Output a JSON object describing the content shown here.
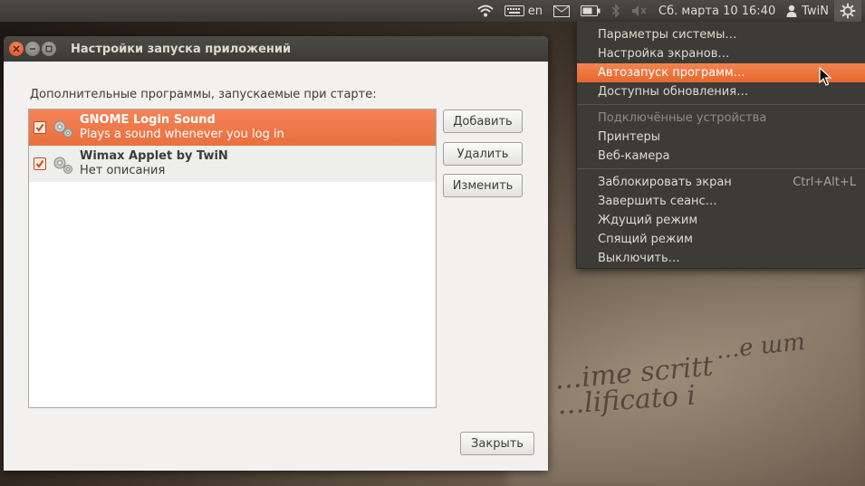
{
  "top_panel": {
    "keyboard_layout": "en",
    "datetime": "Сб. марта 10 16:40",
    "user": "TwiN",
    "icons": [
      "wifi-icon",
      "keyboard-icon",
      "mail-icon",
      "battery-icon",
      "bluetooth-icon",
      "volume-muted-icon",
      "user-icon",
      "settings-gear-icon"
    ]
  },
  "background_text": {
    "line1": "…е шт",
    "line2": "…ime scritt",
    "line3": "…lificato i"
  },
  "window": {
    "title": "Настройки запуска приложений",
    "label": "Дополнительные программы, запускаемые при старте:",
    "items": [
      {
        "title": "GNOME Login Sound",
        "subtitle": "Plays a sound whenever you log in",
        "checked": true,
        "selected": true
      },
      {
        "title": "Wimax Applet by TwiN",
        "subtitle": "Нет описания",
        "checked": true,
        "selected": false
      }
    ],
    "buttons": {
      "add": "Добавить",
      "remove": "Удалить",
      "edit": "Изменить",
      "close": "Закрыть"
    }
  },
  "menu": {
    "items": [
      {
        "label": "Параметры системы…"
      },
      {
        "label": "Настройка экранов…"
      },
      {
        "label": "Автозапуск программ…",
        "highlighted": true
      },
      {
        "label": "Доступны обновления…"
      },
      {
        "separator": true
      },
      {
        "label": "Подключённые устройства",
        "disabled": true
      },
      {
        "label": "Принтеры"
      },
      {
        "label": "Веб-камера"
      },
      {
        "separator": true
      },
      {
        "label": "Заблокировать экран",
        "accel": "Ctrl+Alt+L"
      },
      {
        "label": "Завершить сеанс…"
      },
      {
        "label": "Ждущий режим"
      },
      {
        "label": "Спящий режим"
      },
      {
        "label": "Выключить…"
      }
    ]
  },
  "colors": {
    "accent": "#e9703f",
    "panel": "#3c3b37",
    "window_bg": "#f2f1f0"
  }
}
